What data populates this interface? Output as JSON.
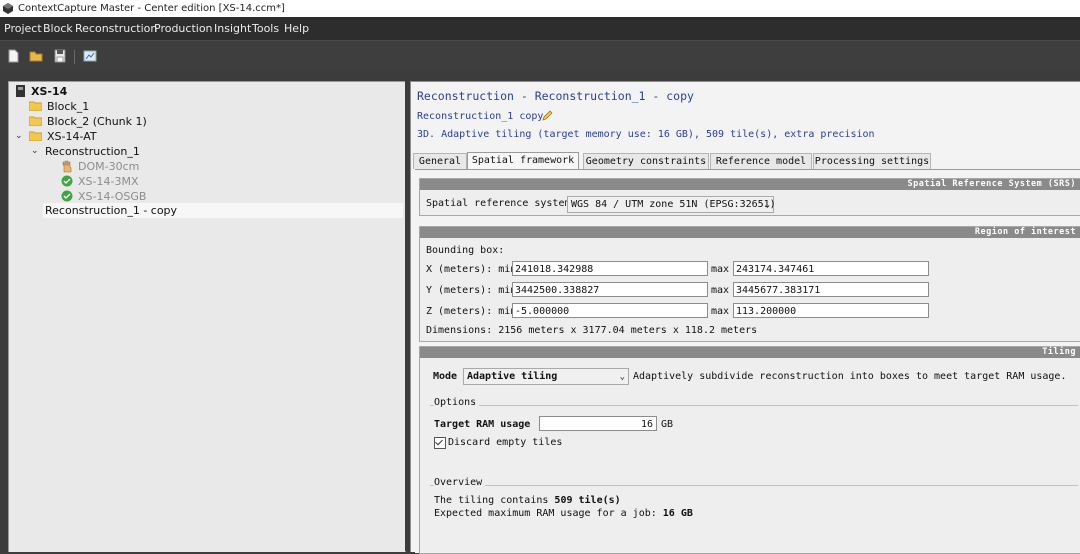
{
  "window": {
    "title": "ContextCapture Master - Center edition [XS-14.ccm*]"
  },
  "menu": [
    "Project",
    "Block",
    "Reconstruction",
    "Production",
    "Insight",
    "Tools",
    "Help"
  ],
  "tree": {
    "root": "XS-14",
    "block1": "Block_1",
    "block2": "Block_2 (Chunk 1)",
    "block_at": "XS-14-AT",
    "recon1": "Reconstruction_1",
    "prod_dom": "DOM-30cm",
    "prod_3mx": "XS-14-3MX",
    "prod_osgb": "XS-14-OSGB",
    "recon_copy": "Reconstruction_1 - copy"
  },
  "detail": {
    "title": "Reconstruction - Reconstruction_1 - copy",
    "name": "Reconstruction_1 copy",
    "description": "3D. Adaptive tiling (target memory use: 16 GB), 509 tile(s), extra precision",
    "tabs": [
      "General",
      "Spatial framework",
      "Geometry constraints",
      "Reference model",
      "Processing settings"
    ],
    "active_tab": "Spatial framework"
  },
  "srs": {
    "header": "Spatial Reference System (SRS)",
    "label": "Spatial reference system:",
    "value": "WGS 84 / UTM zone 51N (EPSG:32651)"
  },
  "roi": {
    "header": "Region of interest",
    "bbox_label": "Bounding box:",
    "x_label": "X (meters): min",
    "y_label": "Y (meters): min",
    "z_label": "Z (meters): min",
    "max_label": "max",
    "x_min": "241018.342988",
    "x_max": "243174.347461",
    "y_min": "3442500.338827",
    "y_max": "3445677.383171",
    "z_min": "-5.000000",
    "z_max": "113.200000",
    "dimensions": "Dimensions: 2156 meters x 3177.04 meters x 118.2 meters"
  },
  "tiling": {
    "header": "Tiling",
    "mode_label": "Mode",
    "mode_value": "Adaptive tiling",
    "mode_desc": "Adaptively subdivide reconstruction into boxes to meet target RAM usage.",
    "options_label": "Options",
    "ram_label": "Target RAM usage",
    "ram_value": "16",
    "ram_unit": "GB",
    "discard_label": "Discard empty tiles",
    "discard_checked": true,
    "overview_label": "Overview",
    "overview_line1_prefix": "The tiling contains ",
    "overview_line1_bold": "509 tile(s)",
    "overview_line2_prefix": "Expected maximum RAM usage for a job: ",
    "overview_line2_bold": "16 GB"
  },
  "colors": {
    "link_blue": "#2a3f9a",
    "group_header": "#8a8a8a",
    "menubar": "#2d2d2d"
  }
}
